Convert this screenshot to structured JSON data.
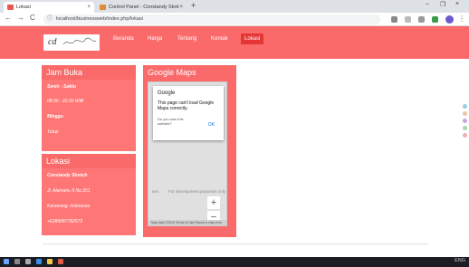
{
  "browser": {
    "tabs": [
      {
        "title": "Lokasi",
        "close": "×"
      },
      {
        "title": "Control Panel - Constandy Stret",
        "close": "×"
      }
    ],
    "new_tab": "+",
    "window_controls": {
      "minimize": "–",
      "restore": "❐",
      "close": "×"
    },
    "url": "localhost/businessweb/index.php/lokasi",
    "nav": {
      "back": "←",
      "forward": "→",
      "reload": "C",
      "info": "ⓘ"
    },
    "menu": "⋮"
  },
  "site": {
    "logo_text": "cd",
    "nav_items": [
      "Beranda",
      "Harga",
      "Tentang",
      "Kontak",
      "Lokasi"
    ],
    "active_nav": "Lokasi",
    "accent": "#fb6a6a"
  },
  "jam_buka": {
    "title": "Jam Buka",
    "rows": [
      "Senin - Sabtu",
      "08.00 - 22.00 WIB",
      "Minggu",
      "Tutup"
    ]
  },
  "lokasi": {
    "title": "Lokasi",
    "rows": [
      "Constandy Stretch",
      "Jl. Alamanu II No.351",
      "Karawang, Indonesia",
      "+6285887782573"
    ]
  },
  "maps": {
    "title": "Google Maps",
    "error_brand": "Google",
    "error_title": "This page can't load Google Maps correctly.",
    "error_question": "Do you own this website?",
    "ok": "OK",
    "watermark_left": "ses",
    "watermark_right": "For development purposes only",
    "zoom_in": "+",
    "zoom_out": "−",
    "footer": "Map data ©2019 Terms of Use Report a map error"
  },
  "taskbar": {
    "tray": "ENG"
  }
}
